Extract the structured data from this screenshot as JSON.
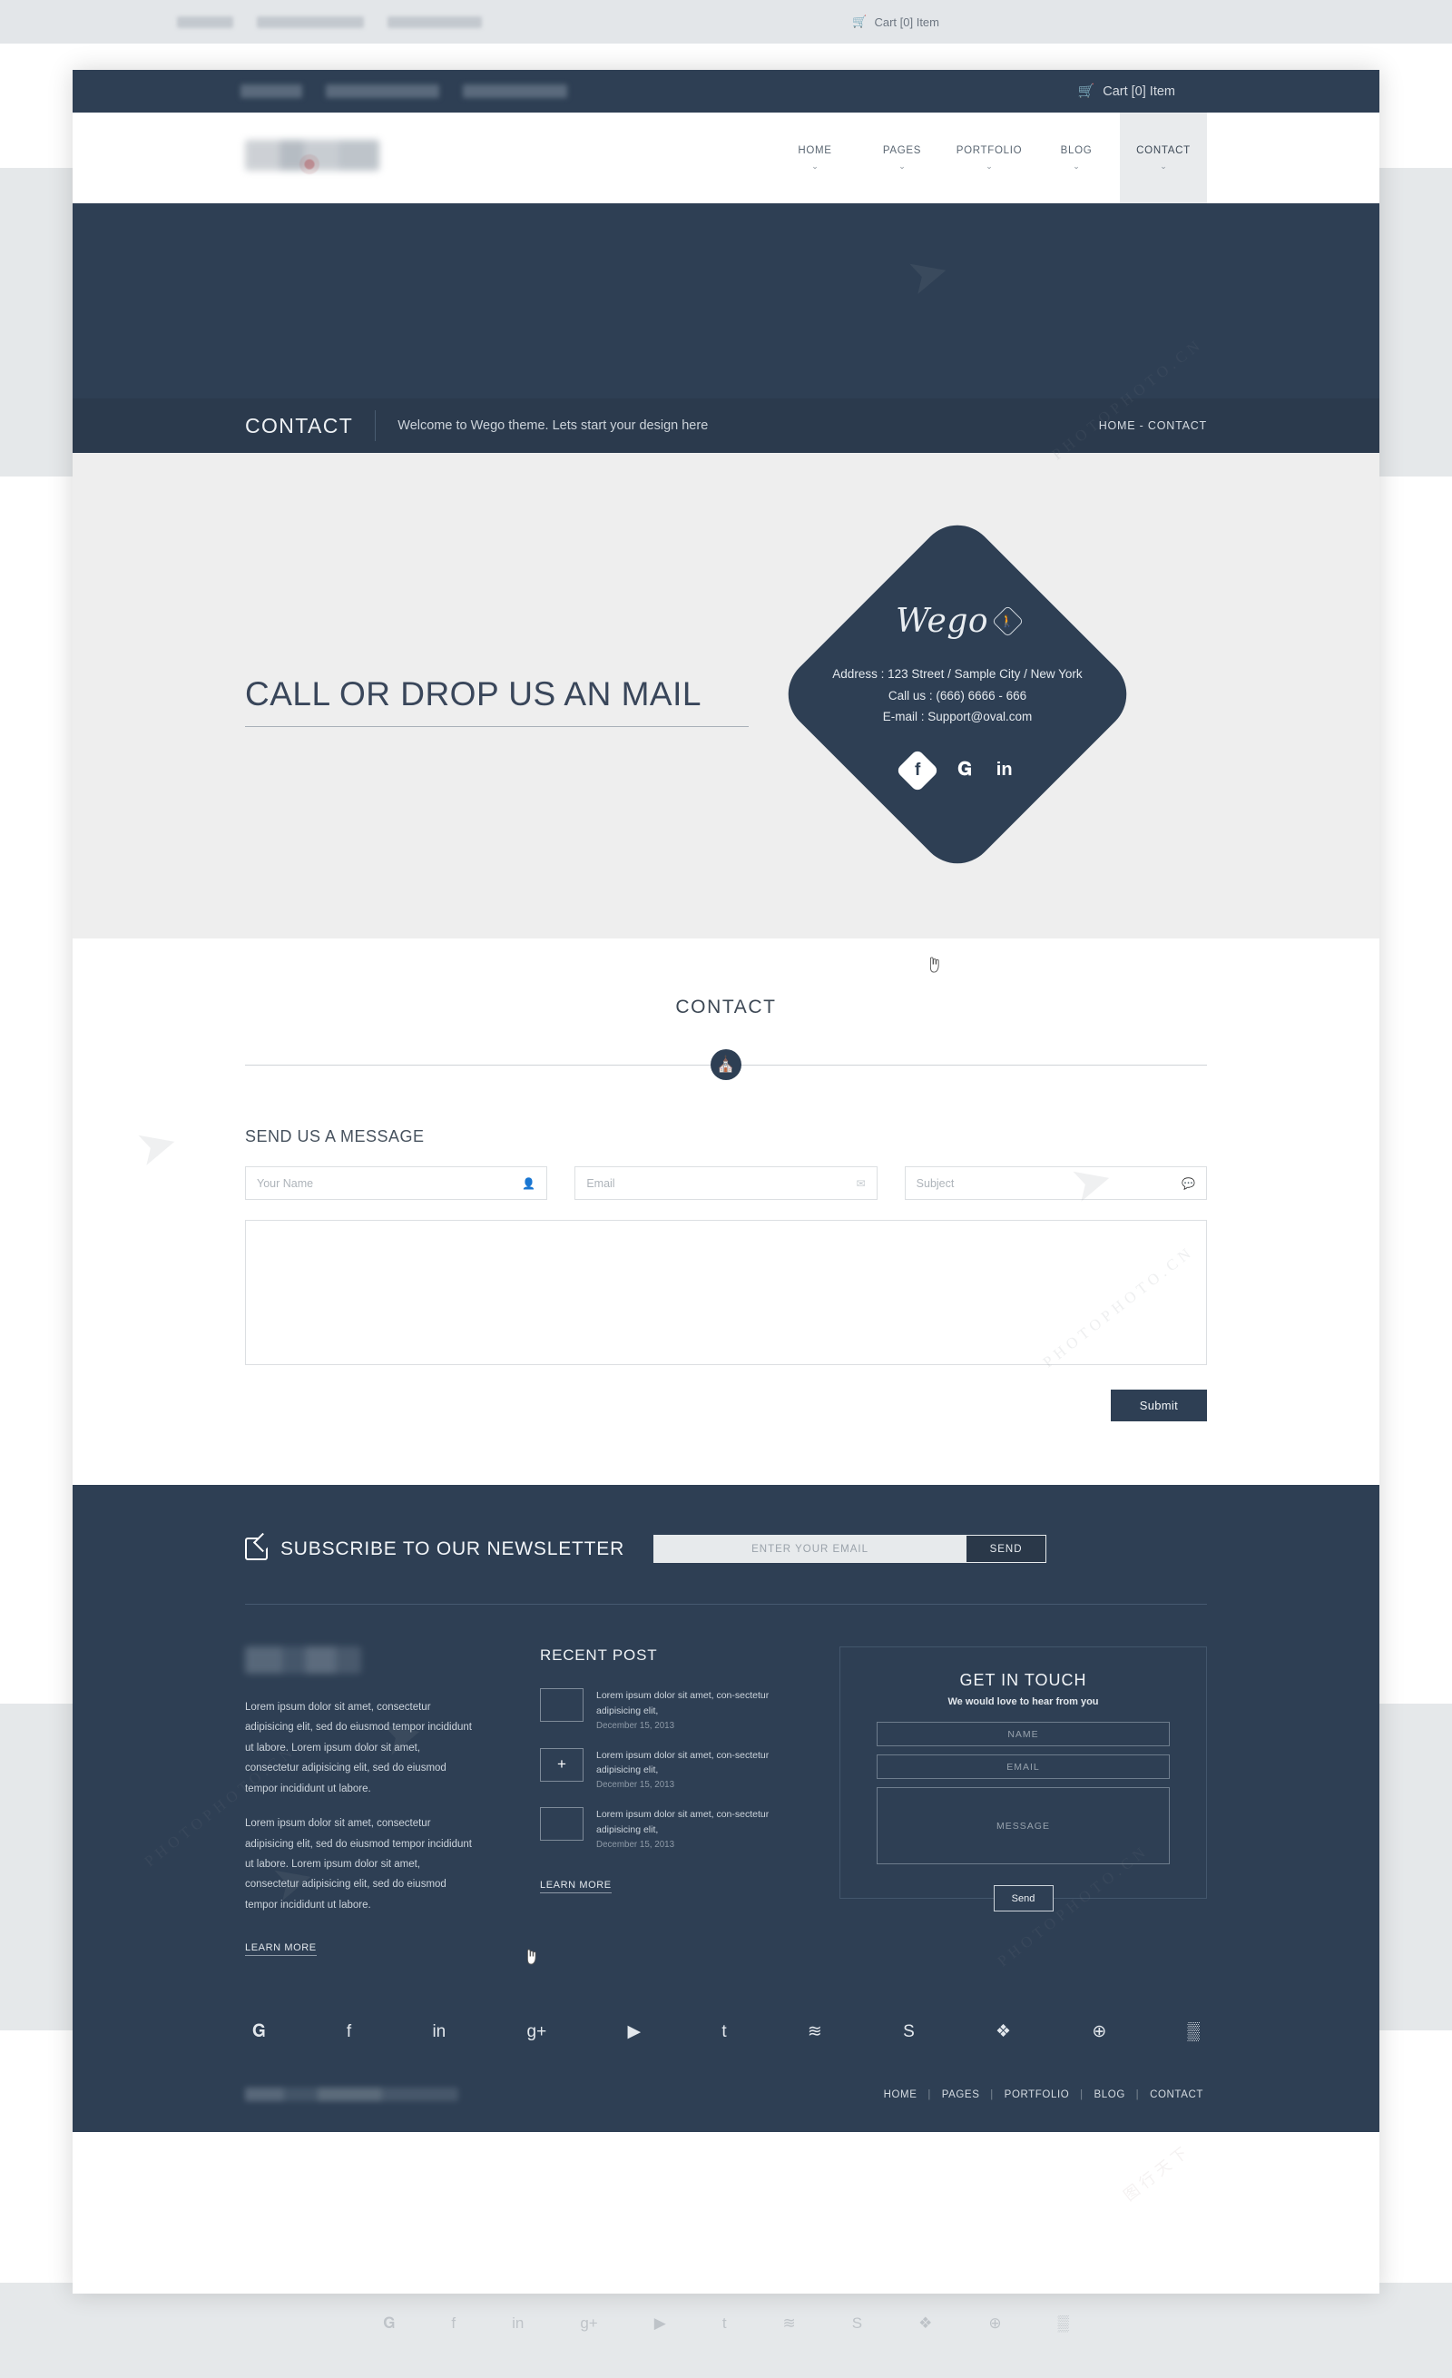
{
  "topbar": {
    "cart_label": "Cart [0] Item",
    "cart_icon": "cart-icon"
  },
  "header": {
    "nav": [
      {
        "label": "HOME",
        "caret": "⌄",
        "active": false
      },
      {
        "label": "PAGES",
        "caret": "⌄",
        "active": false
      },
      {
        "label": "PORTFOLIO",
        "caret": "⌄",
        "active": false
      },
      {
        "label": "BLOG",
        "caret": "⌄",
        "active": false
      },
      {
        "label": "CONTACT",
        "caret": "⌄",
        "active": true
      }
    ]
  },
  "titlebar": {
    "title": "CONTACT",
    "subtitle": "Welcome to Wego theme. Lets start your design here",
    "breadcrumb": "HOME -  CONTACT"
  },
  "hero": {
    "headline": "CALL OR DROP US AN MAIL",
    "card": {
      "brand": "Wego",
      "brand_badge_icon": "walking-person-icon",
      "address": "Address : 123 Street / Sample City /  New York",
      "phone": "Call us : (666)  6666 - 666",
      "email": "E-mail : Support@oval.com",
      "socials": [
        {
          "name": "facebook-icon",
          "glyph": "f"
        },
        {
          "name": "twitter-icon",
          "glyph": "ᵛ"
        },
        {
          "name": "linkedin-icon",
          "glyph": "in"
        }
      ]
    }
  },
  "contact_section": {
    "title": "CONTACT",
    "divider_icon": "headphones-icon",
    "form_heading": "SEND US A MESSAGE",
    "fields": [
      {
        "placeholder": "Your Name",
        "icon": "user-icon"
      },
      {
        "placeholder": "Email",
        "icon": "envelope-icon"
      },
      {
        "placeholder": "Subject",
        "icon": "comment-icon"
      }
    ],
    "message_placeholder": "",
    "submit_label": "Submit"
  },
  "newsletter": {
    "icon": "pencil-square-icon",
    "title": "SUBSCRIBE TO OUR NEWSLETTER",
    "input_placeholder": "ENTER YOUR EMAIL",
    "send_label": "SEND"
  },
  "footer": {
    "about": {
      "paragraph_1": "Lorem ipsum dolor sit amet, consectetur adipisicing elit, sed do eiusmod tempor incididunt ut labore. Lorem ipsum dolor sit amet, consectetur adipisicing elit, sed do eiusmod tempor incididunt ut labore.",
      "paragraph_2": "Lorem ipsum dolor sit amet, consectetur adipisicing elit, sed do eiusmod tempor incididunt ut labore. Lorem ipsum dolor sit amet, consectetur adipisicing elit, sed do eiusmod tempor incididunt ut labore.",
      "learn_more": "LEARN MORE"
    },
    "recent": {
      "title": "RECENT POST",
      "posts": [
        {
          "text": "Lorem ipsum dolor sit amet, con-sectetur adipisicing elit,",
          "date": "December 15, 2013"
        },
        {
          "text": "Lorem ipsum dolor sit amet, con-sectetur adipisicing elit,",
          "date": "December 15, 2013"
        },
        {
          "text": "Lorem ipsum dolor sit amet, con-sectetur adipisicing elit,",
          "date": "December 15, 2013"
        }
      ],
      "learn_more": "LEARN MORE"
    },
    "touch": {
      "title": "GET IN TOUCH",
      "subtitle": "We would love to hear from you",
      "name_placeholder": "NAME",
      "email_placeholder": "EMAIL",
      "message_placeholder": "MESSAGE",
      "send_label": "Send"
    },
    "socials": [
      {
        "name": "twitter-icon",
        "glyph": "𝒆"
      },
      {
        "name": "facebook-icon",
        "glyph": "f"
      },
      {
        "name": "linkedin-icon",
        "glyph": "in"
      },
      {
        "name": "google-plus-icon",
        "glyph": "g+"
      },
      {
        "name": "youtube-icon",
        "glyph": "You"
      },
      {
        "name": "tumblr-icon",
        "glyph": "t"
      },
      {
        "name": "rss-icon",
        "glyph": "≋"
      },
      {
        "name": "skype-icon",
        "glyph": "S"
      },
      {
        "name": "dropbox-icon",
        "glyph": "❖"
      },
      {
        "name": "dribbble-icon",
        "glyph": "⊕"
      },
      {
        "name": "behance-icon",
        "glyph": "▒"
      }
    ],
    "bottom_nav": [
      "HOME",
      "PAGES",
      "PORTFOLIO",
      "BLOG",
      "CONTACT"
    ],
    "bottom_sep": "|"
  },
  "colors": {
    "navy": "#2e3f54",
    "navy_dark": "#2b3a4d",
    "hero_grey": "#eeeeee",
    "page_grey": "#e5e8ea",
    "text_light": "#cbd3db"
  },
  "watermark": {
    "text_1": "PHOTOPHOTO.CN",
    "text_2": "图行天下"
  }
}
